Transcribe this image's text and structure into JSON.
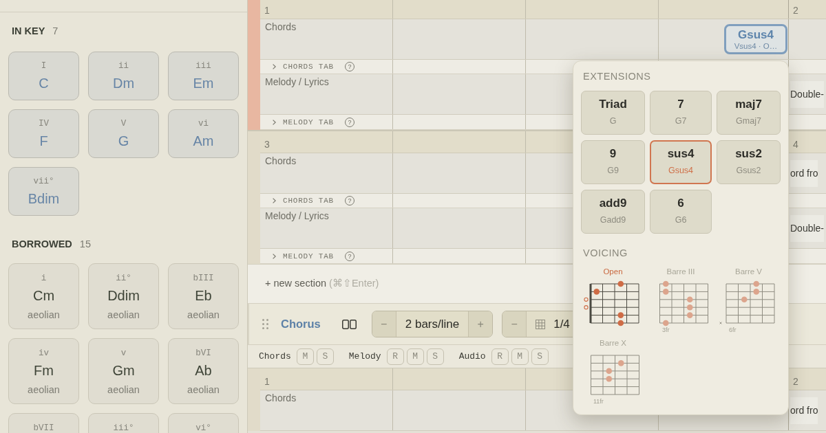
{
  "sidebar": {
    "groups": [
      {
        "kind": "diatonic",
        "title": "IN KEY",
        "count": "7",
        "chords": [
          {
            "numeral": "I",
            "name": "C"
          },
          {
            "numeral": "ii",
            "name": "Dm"
          },
          {
            "numeral": "iii",
            "name": "Em"
          },
          {
            "numeral": "IV",
            "name": "F"
          },
          {
            "numeral": "V",
            "name": "G"
          },
          {
            "numeral": "vi",
            "name": "Am"
          },
          {
            "numeral": "vii°",
            "name": "Bdim"
          }
        ]
      },
      {
        "kind": "borrowed",
        "title": "BORROWED",
        "count": "15",
        "chords": [
          {
            "numeral": "i",
            "name": "Cm",
            "mode": "aeolian"
          },
          {
            "numeral": "ii°",
            "name": "Ddim",
            "mode": "aeolian"
          },
          {
            "numeral": "bIII",
            "name": "Eb",
            "mode": "aeolian"
          },
          {
            "numeral": "iv",
            "name": "Fm",
            "mode": "aeolian"
          },
          {
            "numeral": "v",
            "name": "Gm",
            "mode": "aeolian"
          },
          {
            "numeral": "bVI",
            "name": "Ab",
            "mode": "aeolian"
          },
          {
            "numeral": "bVII"
          },
          {
            "numeral": "iii°"
          },
          {
            "numeral": "vi°"
          }
        ]
      }
    ]
  },
  "editor": [
    {
      "kind": "section",
      "lines": [
        {
          "selected": true,
          "bar_numbers": [
            "1",
            "2"
          ],
          "rows": [
            {
              "kind": "lane",
              "label": "Chords",
              "cells": [
                {},
                {},
                {},
                {
                  "chord": {
                    "name": "Gsus4",
                    "detail": "Vsus4 · O…",
                    "selected": true
                  }
                }
              ]
            },
            {
              "kind": "tab",
              "label": "CHORDS TAB",
              "help": "?"
            },
            {
              "kind": "lane",
              "label": "Melody / Lyrics",
              "cells": [
                {},
                {},
                {},
                {},
                {
                  "text": "Double-"
                }
              ]
            },
            {
              "kind": "tab",
              "label": "MELODY TAB",
              "help": "?"
            }
          ]
        },
        {
          "selected": false,
          "bar_numbers": [
            "3",
            "4"
          ],
          "rows": [
            {
              "kind": "lane",
              "label": "Chords",
              "cells": [
                {},
                {},
                {},
                {},
                {
                  "text": "ord fro"
                }
              ]
            },
            {
              "kind": "tab",
              "label": "CHORDS TAB",
              "help": "?"
            },
            {
              "kind": "lane",
              "label": "Melody / Lyrics",
              "cells": [
                {},
                {},
                {},
                {},
                {
                  "text": "Double-"
                }
              ]
            },
            {
              "kind": "tab",
              "label": "MELODY TAB",
              "help": "?"
            }
          ]
        }
      ]
    },
    {
      "kind": "add_section",
      "label": "+ new section",
      "shortcut": "(⌘⇧Enter)"
    },
    {
      "kind": "section",
      "title": "Chorus",
      "steppers": [
        {
          "kind": "count",
          "minus": "−",
          "value": "2 bars/line",
          "plus": "+"
        },
        {
          "kind": "grid",
          "minus": "−",
          "value": "1/4"
        }
      ],
      "tracks": [
        {
          "name": "Chords",
          "toggles": [
            "M",
            "S"
          ]
        },
        {
          "name": "Melody",
          "toggles": [
            "R",
            "M",
            "S"
          ]
        },
        {
          "name": "Audio",
          "toggles": [
            "R",
            "M",
            "S"
          ]
        }
      ],
      "lines": [
        {
          "selected": false,
          "bar_numbers": [
            "1",
            "2"
          ],
          "rows": [
            {
              "kind": "lane",
              "label": "Chords",
              "cells": [
                {},
                {},
                {},
                {},
                {
                  "text": "ord fro"
                }
              ]
            }
          ]
        }
      ]
    }
  ],
  "popover": {
    "extensions": {
      "title": "EXTENSIONS",
      "options": [
        {
          "name": "Triad",
          "chord": "G",
          "selected": false
        },
        {
          "name": "7",
          "chord": "G7",
          "selected": false
        },
        {
          "name": "maj7",
          "chord": "Gmaj7",
          "selected": false
        },
        {
          "name": "9",
          "chord": "G9",
          "selected": false
        },
        {
          "name": "sus4",
          "chord": "Gsus4",
          "selected": true
        },
        {
          "name": "sus2",
          "chord": "Gsus2",
          "selected": false
        },
        {
          "name": "add9",
          "chord": "Gadd9",
          "selected": false
        },
        {
          "name": "6",
          "chord": "G6",
          "selected": false
        }
      ]
    },
    "voicing": {
      "title": "VOICING",
      "options": [
        {
          "label": "Open",
          "selected": true
        },
        {
          "label": "Barre III",
          "fret_label": "3fr",
          "selected": false
        },
        {
          "label": "Barre V",
          "fret_label": "6fr",
          "selected": false
        },
        {
          "label": "Barre X",
          "fret_label": "11fr",
          "selected": false
        }
      ]
    }
  }
}
